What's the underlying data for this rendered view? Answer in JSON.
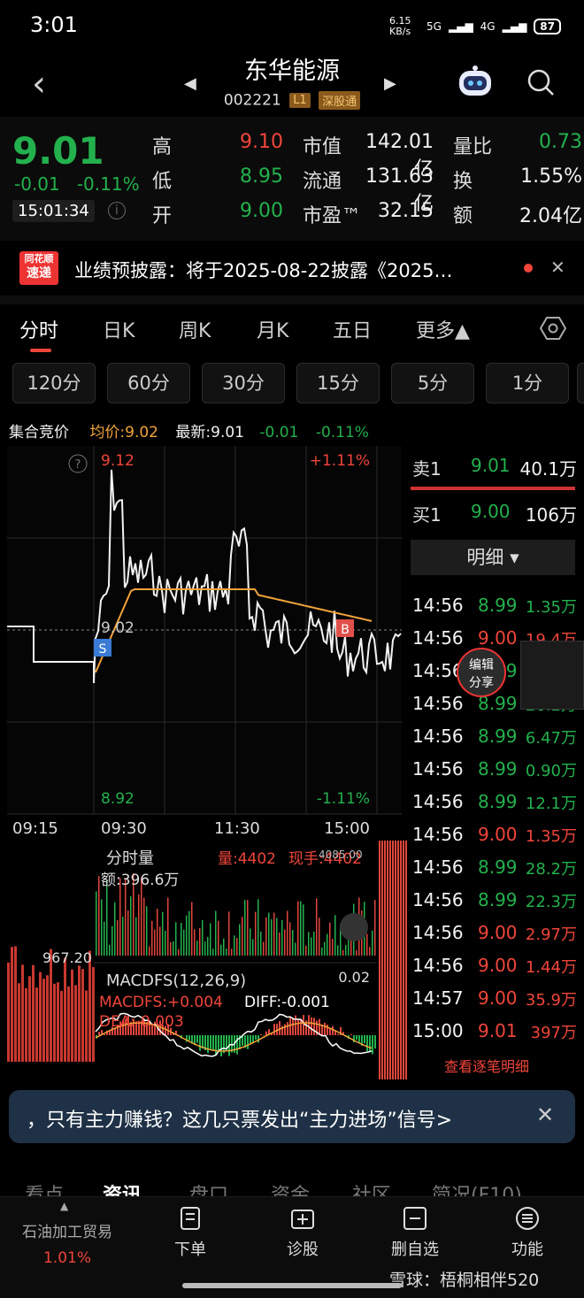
{
  "status_bar": {
    "time": "3:01",
    "speed": "6.15 KB/s",
    "net1": "5G",
    "net2": "4G",
    "battery": "87"
  },
  "header": {
    "stock_name": "东华能源",
    "stock_code": "002221",
    "level_tag": "L1",
    "market_tag": "深股通"
  },
  "quote": {
    "price": "9.01",
    "change": "-0.01",
    "change_pct": "-0.11%",
    "time": "15:01:34",
    "rows": [
      {
        "l1": "高",
        "v1": "9.10",
        "l2": "市值",
        "v2": "142.01亿",
        "l3": "量比",
        "v3": "0.73"
      },
      {
        "l1": "低",
        "v1": "8.95",
        "l2": "流通",
        "v2": "131.63亿",
        "l3": "换",
        "v3": "1.55%"
      },
      {
        "l1": "开",
        "v1": "9.00",
        "l2": "市盈™",
        "v2": "32.15",
        "l3": "额",
        "v3": "2.04亿"
      }
    ]
  },
  "news": {
    "badge_top": "同花顺",
    "badge_bottom": "速递",
    "text": "业绩预披露：将于2025-08-22披露《2025…"
  },
  "kline_tabs": [
    "分时",
    "日K",
    "周K",
    "月K",
    "五日",
    "更多▲"
  ],
  "minute_buttons": [
    "120分",
    "60分",
    "30分",
    "15分",
    "5分",
    "1分"
  ],
  "chart_header": {
    "label": "集合竞价",
    "avg": "均价:9.02",
    "latest": "最新:9.01",
    "chg": "-0.01",
    "chg_pct": "-0.11%"
  },
  "chart_labels": {
    "y_high": "9.12",
    "y_mid": "9.02",
    "y_low": "8.92",
    "pct_high": "+1.11%",
    "pct_low": "-1.11%",
    "t1": "09:15",
    "t2": "09:30",
    "t3": "11:30",
    "t4": "15:00",
    "vol_title": "分时量",
    "vol_value": "量:4402",
    "vol_now": "现手:4402",
    "vol_amount": "额:396.6万",
    "vol_scale": "967.20",
    "vol_max": "4085.00",
    "macd_title": "MACDFS(12,26,9)",
    "macd_max": "0.02",
    "macdfs": "MACDFS:+0.004",
    "diff": "DIFF:-0.001",
    "dea": "DEA:-0.003",
    "marker_s": "S",
    "marker_b": "B"
  },
  "chart_data": {
    "type": "line",
    "ylim": [
      8.92,
      9.12
    ],
    "prev_close": 9.02,
    "x": [
      "09:15",
      "09:30",
      "11:30",
      "15:00"
    ],
    "series": [
      {
        "name": "分时",
        "color": "#f2f2f2"
      },
      {
        "name": "均价",
        "color": "#f3a33a"
      }
    ]
  },
  "order_book": {
    "sell1": {
      "label": "卖1",
      "price": "9.01",
      "vol": "40.1万"
    },
    "buy1": {
      "label": "买1",
      "price": "9.00",
      "vol": "106万"
    },
    "detail_title": "明细 ▾",
    "ticks": [
      {
        "time": "14:56",
        "price": "8.99",
        "vol": "1.35万",
        "color": "green"
      },
      {
        "time": "14:56",
        "price": "9.00",
        "vol": "19.4万",
        "color": "red"
      },
      {
        "time": "14:56",
        "price": "8.99",
        "vol": "26.2万",
        "color": "green"
      },
      {
        "time": "14:56",
        "price": "8.99",
        "vol": "26.2万",
        "color": "green"
      },
      {
        "time": "14:56",
        "price": "8.99",
        "vol": "6.47万",
        "color": "green"
      },
      {
        "time": "14:56",
        "price": "8.99",
        "vol": "0.90万",
        "color": "green"
      },
      {
        "time": "14:56",
        "price": "8.99",
        "vol": "12.1万",
        "color": "green"
      },
      {
        "time": "14:56",
        "price": "9.00",
        "vol": "1.35万",
        "color": "red"
      },
      {
        "time": "14:56",
        "price": "8.99",
        "vol": "28.2万",
        "color": "green"
      },
      {
        "time": "14:56",
        "price": "8.99",
        "vol": "22.3万",
        "color": "green"
      },
      {
        "time": "14:56",
        "price": "9.00",
        "vol": "2.97万",
        "color": "red"
      },
      {
        "time": "14:56",
        "price": "9.00",
        "vol": "1.44万",
        "color": "red"
      },
      {
        "time": "14:57",
        "price": "9.00",
        "vol": "35.9万",
        "color": "red"
      },
      {
        "time": "15:00",
        "price": "9.01",
        "vol": "397万",
        "color": "red"
      }
    ],
    "more_link": "查看逐笔明细",
    "share_btn": "编辑\n分享"
  },
  "banner": {
    "text": "，只有主力赚钱？这几只票发出“主力进场”信号>"
  },
  "bottom_tabs": [
    "看点",
    "资讯",
    "盘口",
    "资金",
    "社区",
    "简况(F10)"
  ],
  "bottom_nav": {
    "sector_name": "石油加工贸易",
    "sector_pct": "1.01%",
    "items": [
      "下单",
      "诊股",
      "删自选",
      "功能"
    ]
  },
  "watermark": "雪球：梧桐相伴520",
  "colors": {
    "up": "#f0453a",
    "down": "#23b14d",
    "avg_line": "#f3a33a",
    "background": "#000000"
  }
}
